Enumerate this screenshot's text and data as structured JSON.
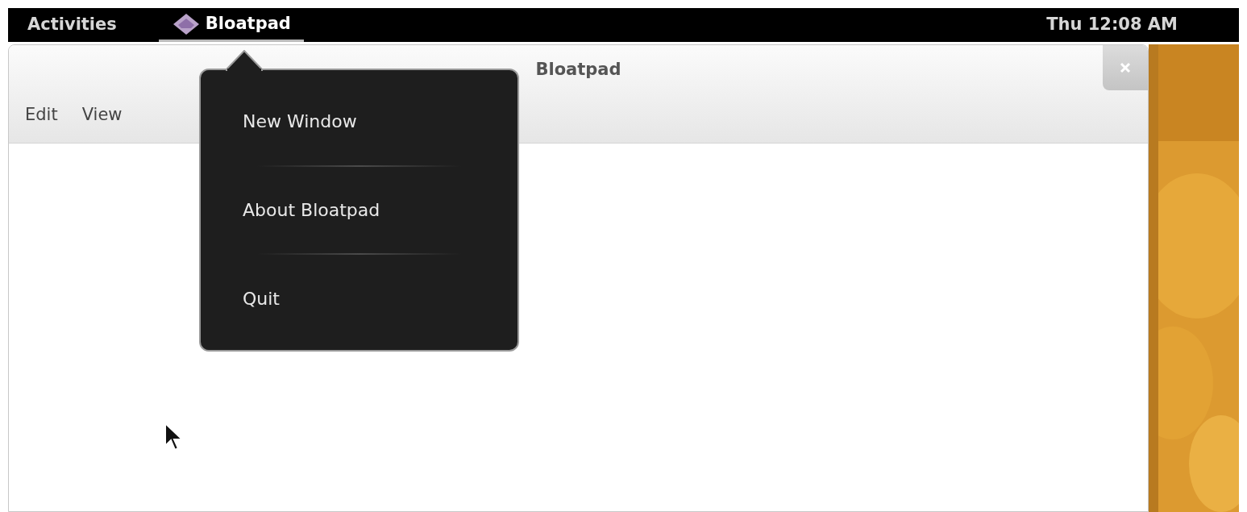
{
  "top_bar": {
    "activities": "Activities",
    "app_menu": {
      "label": "Bloatpad",
      "expanded": true
    },
    "clock": "Thu 12:08 AM"
  },
  "window": {
    "title": "Bloatpad",
    "menu": [
      "Edit",
      "View"
    ]
  },
  "app_menu_popup": {
    "items": [
      {
        "label": "New Window"
      },
      {
        "label": "About Bloatpad"
      },
      {
        "label": "Quit"
      }
    ]
  }
}
